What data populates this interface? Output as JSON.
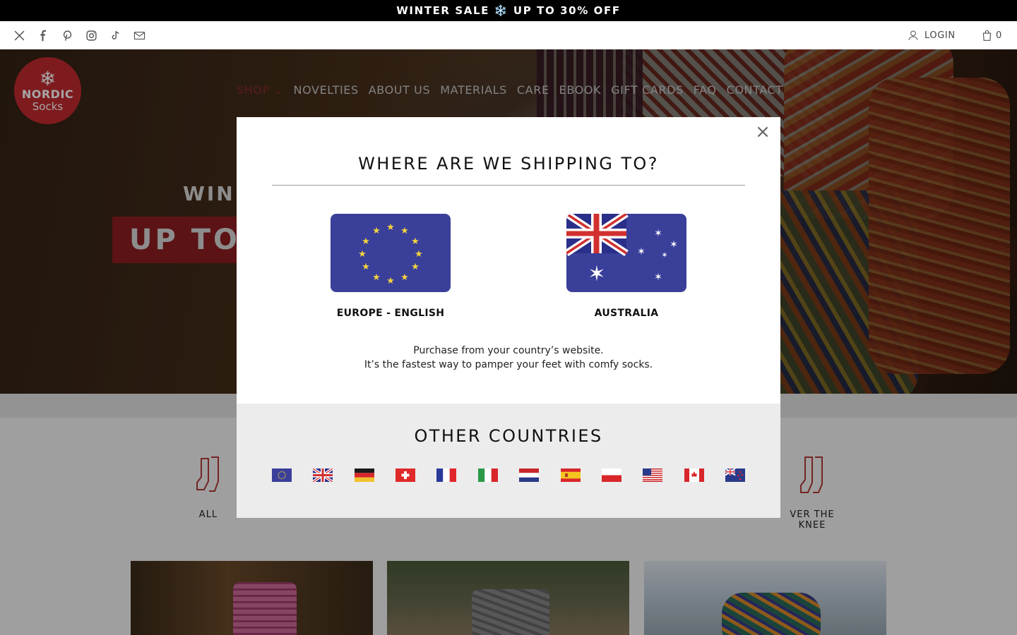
{
  "announcement": {
    "text": "WINTER SALE ❄️ UP TO 30% OFF"
  },
  "social_icons": [
    "x-icon",
    "facebook-icon",
    "pinterest-icon",
    "instagram-icon",
    "tiktok-icon",
    "email-icon"
  ],
  "header": {
    "login_label": "LOGIN",
    "cart_count": "0"
  },
  "logo": {
    "line1": "NORDIC",
    "line2": "Socks"
  },
  "nav": {
    "items": [
      "SHOP",
      "NOVELTIES",
      "ABOUT US",
      "MATERIALS",
      "CARE",
      "EBOOK",
      "GIFT CARDS",
      "FAQ",
      "CONTACT"
    ]
  },
  "hero": {
    "line1": "WIN",
    "line2": "UP TO"
  },
  "categories": [
    {
      "label": "ALL"
    },
    {
      "label": "VER THE KNEE"
    }
  ],
  "modal": {
    "title": "WHERE ARE WE SHIPPING TO?",
    "close_label": "×",
    "regions": [
      {
        "label": "EUROPE - ENGLISH"
      },
      {
        "label": "AUSTRALIA"
      }
    ],
    "message_line1": "Purchase from your country’s website.",
    "message_line2": "It’s the fastest way to pamper your feet with comfy socks.",
    "other_title": "OTHER COUNTRIES",
    "other_flags": [
      "eu-flag-icon",
      "uk-flag-icon",
      "germany-flag-icon",
      "switzerland-flag-icon",
      "france-flag-icon",
      "italy-flag-icon",
      "netherlands-flag-icon",
      "spain-flag-icon",
      "poland-flag-icon",
      "usa-flag-icon",
      "canada-flag-icon",
      "new-zealand-flag-icon"
    ]
  },
  "colors": {
    "brand_red": "#c22a2e",
    "eu_blue": "#3a3f9a",
    "star_yellow": "#f5d43c"
  }
}
